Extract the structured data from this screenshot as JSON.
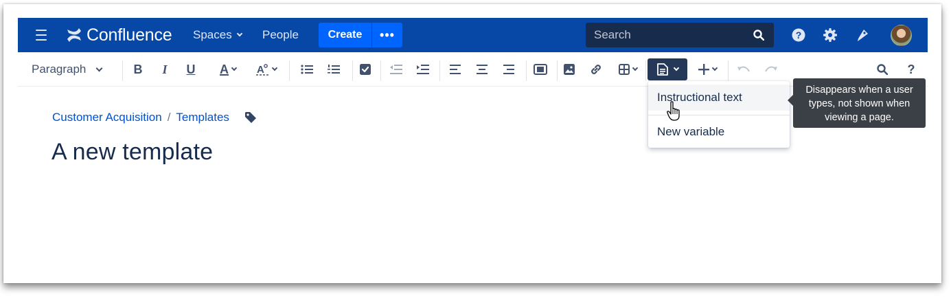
{
  "nav": {
    "app_name": "Confluence",
    "spaces_label": "Spaces",
    "people_label": "People",
    "create_label": "Create",
    "more_label": "•••",
    "search_placeholder": "Search",
    "brand_color": "#0747a6",
    "create_color": "#0065ff"
  },
  "toolbar": {
    "paragraph_label": "Paragraph",
    "bold_label": "B",
    "italic_label": "I",
    "underline_label": "U",
    "text_color_label": "A",
    "icons": [
      "text-color-icon",
      "clear-formatting-icon",
      "bullet-list-icon",
      "numbered-list-icon",
      "task-list-icon",
      "outdent-icon",
      "indent-icon",
      "align-left-icon",
      "align-center-icon",
      "align-right-icon",
      "page-layout-icon",
      "image-icon",
      "link-icon",
      "table-icon",
      "template-icon",
      "insert-more-icon",
      "undo-icon",
      "redo-icon",
      "find-icon",
      "help-icon"
    ]
  },
  "breadcrumb": {
    "items": [
      "Customer Acquisition",
      "Templates"
    ],
    "separator": "/"
  },
  "page": {
    "title": "A new template"
  },
  "dropdown": {
    "items": [
      "Instructional text",
      "New variable"
    ]
  },
  "tooltip": {
    "lines": [
      "Disappears when a user",
      "types, not shown when",
      "viewing a page."
    ]
  }
}
